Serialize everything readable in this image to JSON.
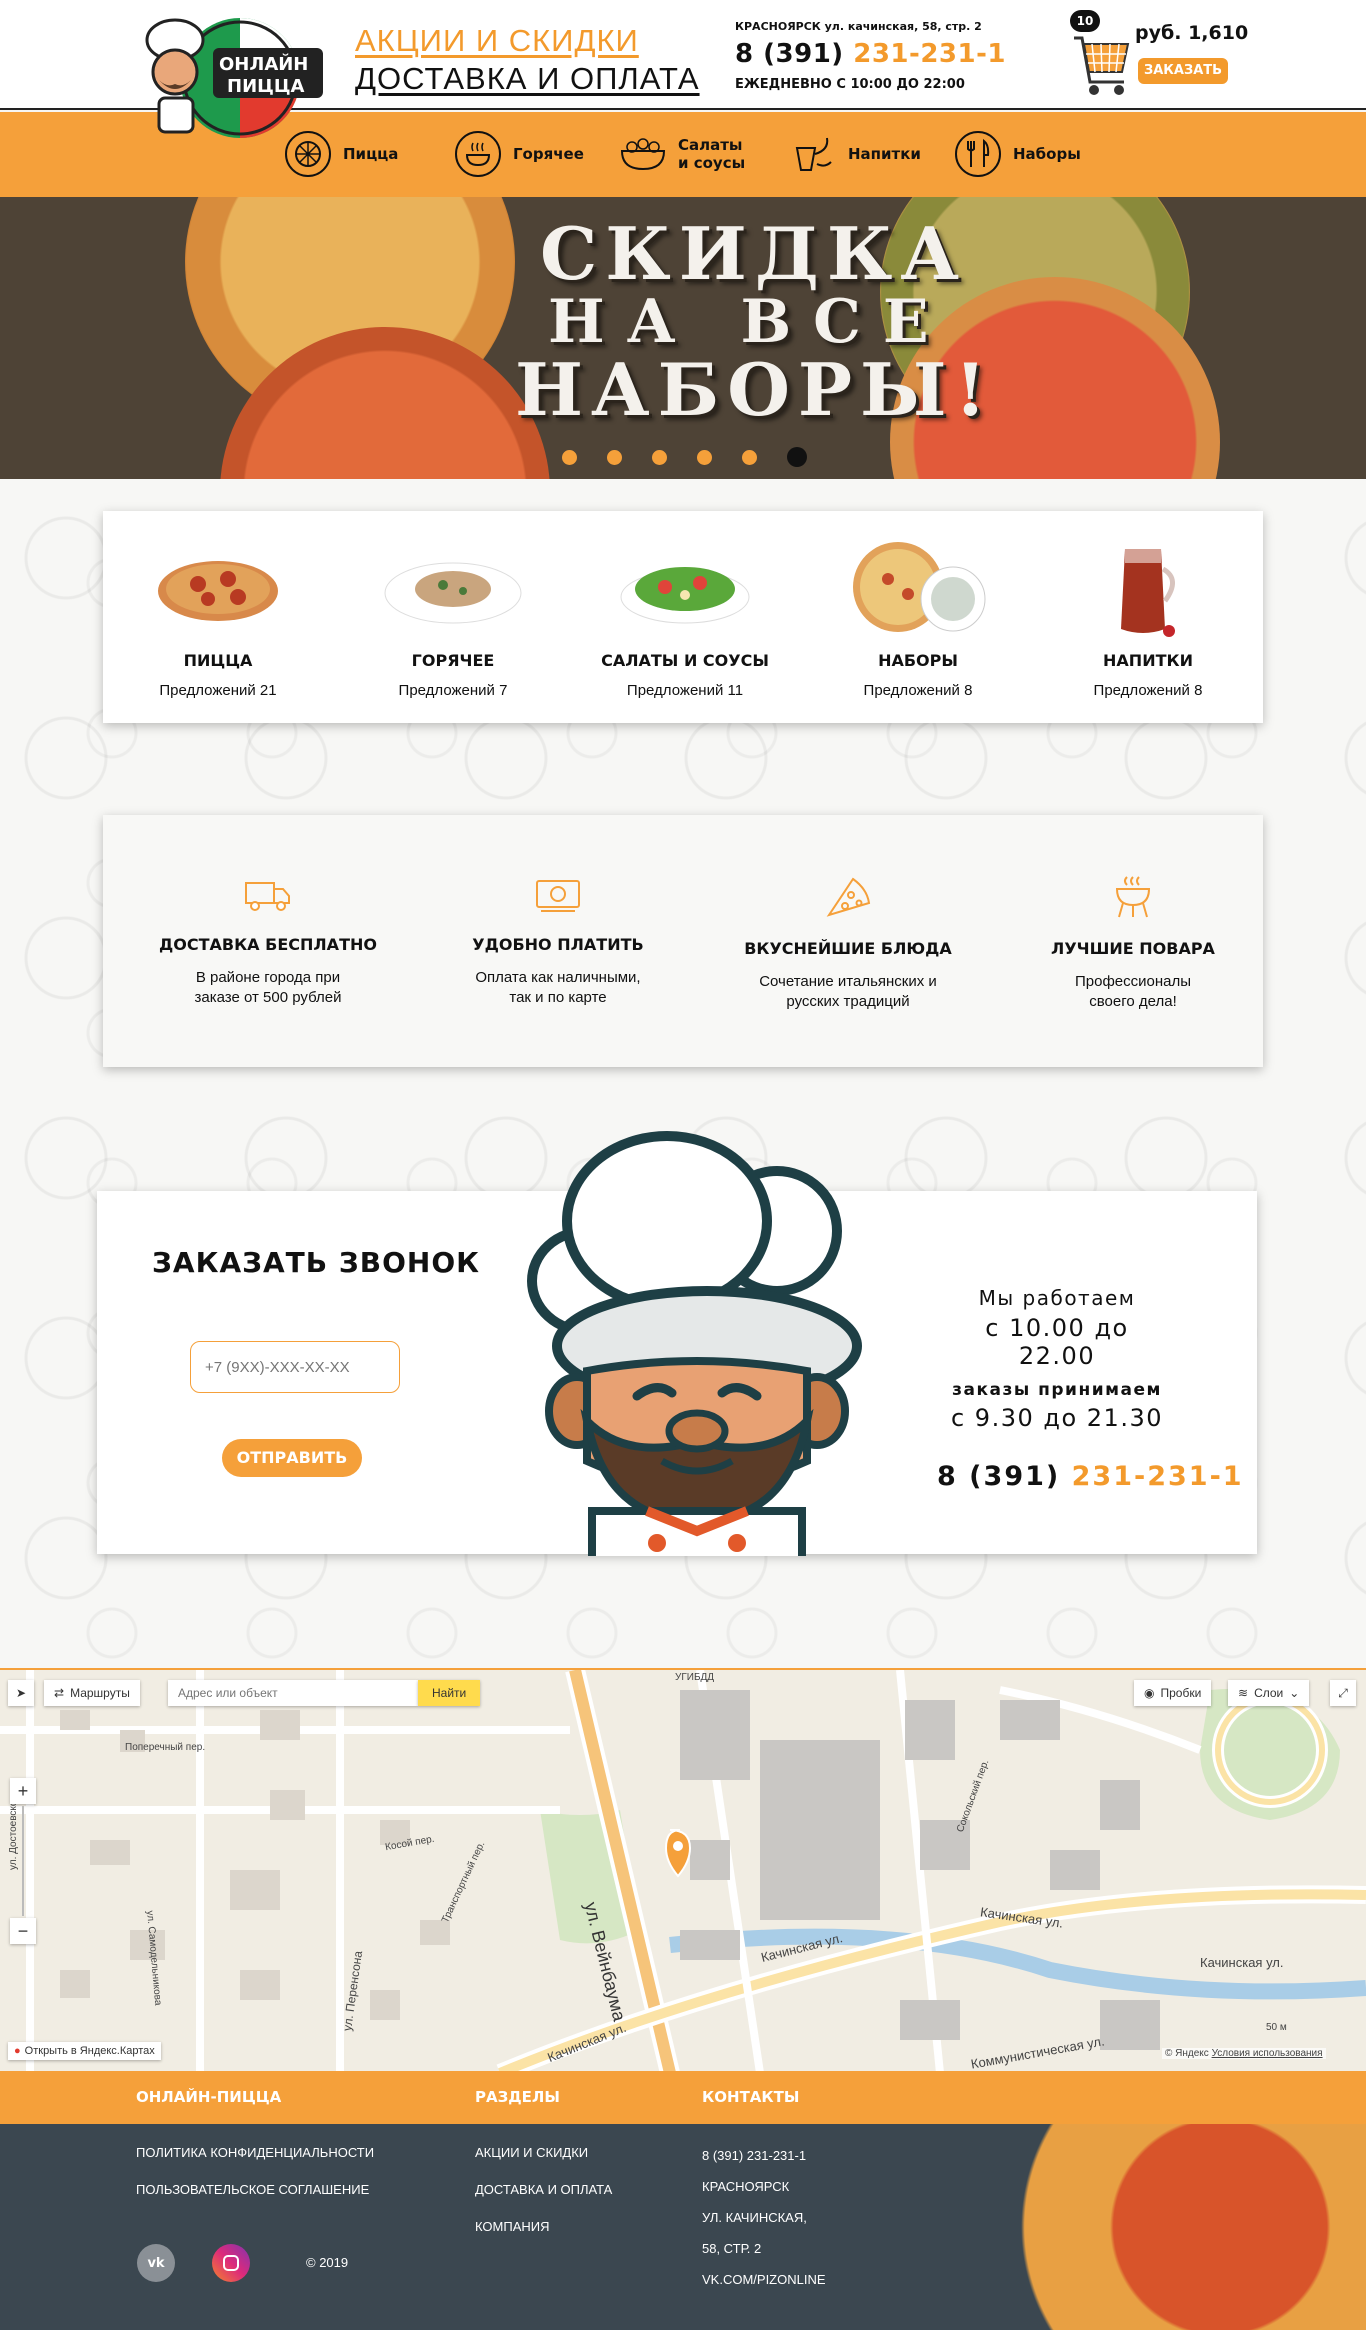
{
  "header": {
    "link_sales": "АКЦИИ И СКИДКИ",
    "link_delivery": "ДОСТАВКА И ОПЛАТА",
    "address": "КРАСНОЯРСК ул. качинская, 58, стр. 2",
    "phone_prefix": "8 (391)",
    "phone_number": "231-231-1",
    "hours": "ЕЖЕДНЕВНО С 10:00 ДО 22:00",
    "cart_count": "10",
    "cart_total": "руб. 1,610",
    "order_label": "ЗАКАЗАТЬ",
    "logo_text_1": "ОНЛАЙН",
    "logo_text_2": "ПИЦЦА"
  },
  "nav": [
    {
      "label": "Пицца",
      "icon": "pizza-icon"
    },
    {
      "label": "Горячее",
      "icon": "hot-dish-icon"
    },
    {
      "label": "Салаты и соусы",
      "icon": "salad-icon"
    },
    {
      "label": "Напитки",
      "icon": "drinks-icon"
    },
    {
      "label": "Наборы",
      "icon": "cutlery-icon"
    }
  ],
  "banner": {
    "line1": "СКИДКА",
    "line2": "НА ВСЕ",
    "line3": "НАБОРЫ!",
    "slides": 6,
    "active_slide": 6
  },
  "categories": [
    {
      "title": "ПИЦЦА",
      "count": "Предложений 21"
    },
    {
      "title": "ГОРЯЧЕЕ",
      "count": "Предложений 7"
    },
    {
      "title": "САЛАТЫ И СОУСЫ",
      "count": "Предложений 11"
    },
    {
      "title": "НАБОРЫ",
      "count": "Предложений 8"
    },
    {
      "title": "НАПИТКИ",
      "count": "Предложений 8"
    }
  ],
  "features": [
    {
      "title": "ДОСТАВКА БЕСПЛАТНО",
      "line1": "В районе города при",
      "line2": "заказе от 500 рублей",
      "icon": "truck-icon"
    },
    {
      "title": "УДОБНО ПЛАТИТЬ",
      "line1": "Оплата как наличными,",
      "line2": "так и по карте",
      "icon": "payment-icon"
    },
    {
      "title": "ВКУСНЕЙШИЕ БЛЮДА",
      "line1": "Сочетание итальянских и",
      "line2": "русских традиций",
      "icon": "pizza-slice-icon"
    },
    {
      "title": "ЛУЧШИЕ ПОВАРА",
      "line1": "Профессионалы",
      "line2": "своего дела!",
      "icon": "grill-icon"
    }
  ],
  "callback": {
    "title": "ЗАКАЗАТЬ ЗВОНОК",
    "placeholder": "+7 (9XX)-XXX-XX-XX",
    "send_label": "ОТПРАВИТЬ",
    "work_1": "Мы работаем",
    "work_2": "с 10.00 до 22.00",
    "work_3": "заказы принимаем",
    "work_4": "с 9.30 до 21.30",
    "phone_prefix": "8 (391)",
    "phone_number": "231-231-1"
  },
  "map": {
    "routes_label": "Маршруты",
    "search_placeholder": "Адрес или объект",
    "find_label": "Найти",
    "traffic_label": "Пробки",
    "layers_label": "Слои",
    "open_label": "Открыть в Яндекс.Картах",
    "copyright": "© Яндекс",
    "terms": "Условия использования",
    "scale": "50 м",
    "streets": {
      "weinbaum": "ул. Вейнбаума",
      "kachinskaya": "Качинская ул.",
      "kommunisticheskaya": "Коммунистическая ул.",
      "perensona": "ул. Перенсона",
      "dostoevskogo": "ул. Достоевского",
      "samodelnikova": "ул. Самодельникова",
      "poperechny": "Поперечный пер.",
      "kosoy": "Косой пер.",
      "transportny": "Транспортный пер.",
      "sokolsky": "Сокольский пер.",
      "gibdd": "УГИБДД"
    }
  },
  "footer": {
    "col1_title": "ОНЛАЙН-ПИЦЦА",
    "col2_title": "РАЗДЕЛЫ",
    "col3_title": "КОНТАКТЫ",
    "privacy": "ПОЛИТИКА КОНФИДЕНЦИАЛЬНОСТИ",
    "agreement": "ПОЛЬЗОВАТЕЛЬСКОЕ СОГЛАШЕНИЕ",
    "copyright": "© 2019",
    "sections": [
      "АКЦИИ И СКИДКИ",
      "ДОСТАВКА И ОПЛАТА",
      "КОМПАНИЯ"
    ],
    "contacts": [
      "8 (391) 231-231-1",
      "КРАСНОЯРСК",
      "УЛ. КАЧИНСКАЯ,",
      "58, СТР. 2",
      "VK.COM/PIZONLINE"
    ],
    "vk_label": "vk"
  },
  "colors": {
    "accent": "#f5a03a",
    "dark": "#111111",
    "footer": "#3b4750"
  }
}
